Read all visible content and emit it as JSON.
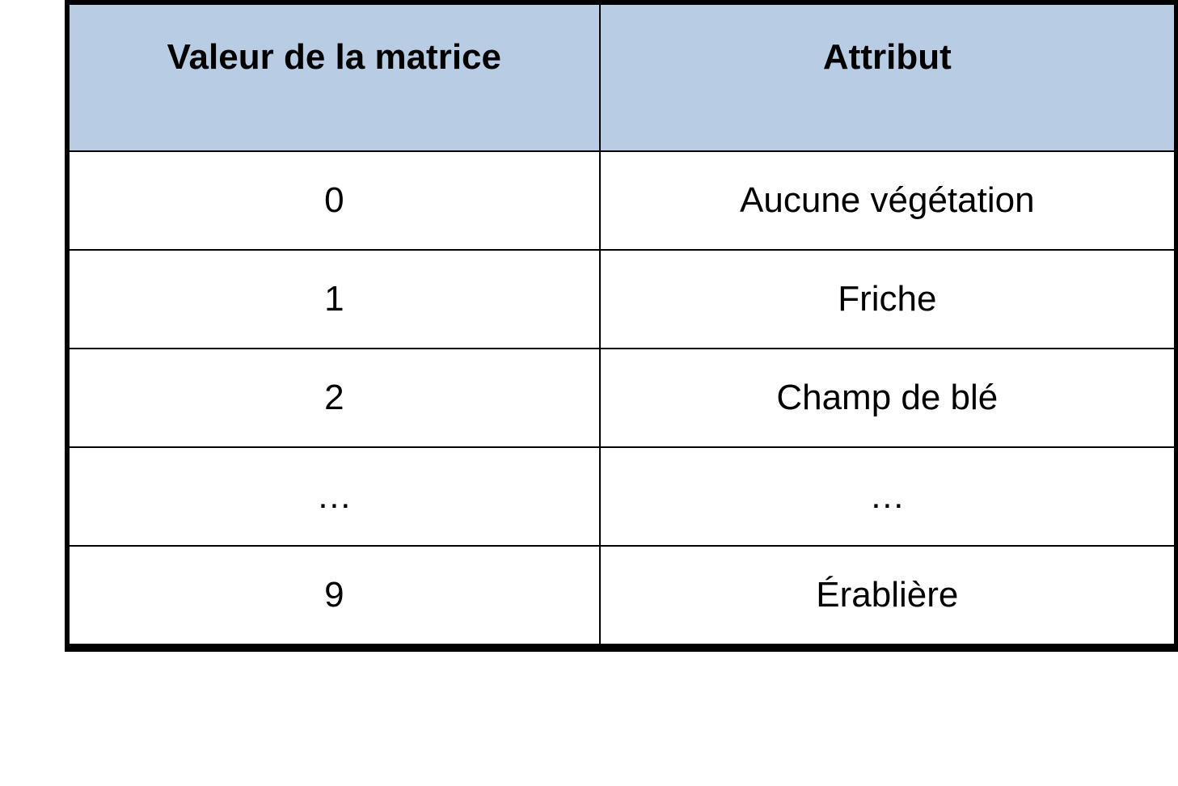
{
  "table": {
    "headers": {
      "col1": "Valeur de la matrice",
      "col2": "Attribut"
    },
    "rows": [
      {
        "value": "0",
        "attribute": "Aucune végétation"
      },
      {
        "value": "1",
        "attribute": "Friche"
      },
      {
        "value": "2",
        "attribute": "Champ de blé"
      },
      {
        "value": "…",
        "attribute": "…"
      },
      {
        "value": "9",
        "attribute": "Érablière"
      }
    ]
  }
}
